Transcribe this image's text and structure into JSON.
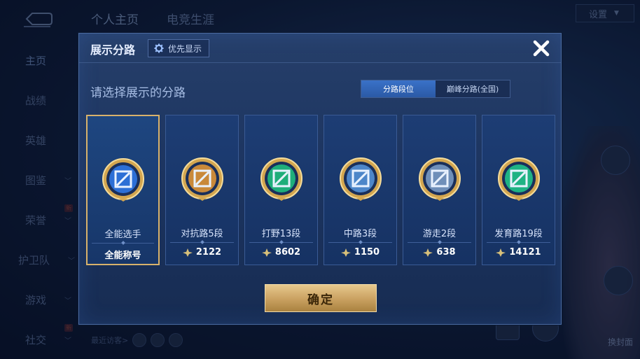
{
  "background": {
    "top_tabs": [
      "个人主页",
      "电竞生涯"
    ],
    "settings_label": "设置",
    "side_nav": [
      {
        "label": "主页"
      },
      {
        "label": "战绩"
      },
      {
        "label": "英雄"
      },
      {
        "label": "图鉴"
      },
      {
        "label": "荣誉"
      },
      {
        "label": "护卫队"
      },
      {
        "label": "游戏"
      },
      {
        "label": "社交"
      }
    ],
    "new_badge": "新",
    "recent_visitors": "最近访客>",
    "replace_cover": "换封面"
  },
  "dialog": {
    "title": "展示分路",
    "priority_button": "优先显示",
    "choose_label": "请选择展示的分路",
    "segment": {
      "options": [
        "分路段位",
        "巅峰分路(全国)"
      ],
      "selected": "分路段位"
    },
    "cards": [
      {
        "role": "全能选手",
        "score": "全能称号",
        "selected": true,
        "emblem": "all-round-emblem-icon",
        "color": "#2c6fd6"
      },
      {
        "role": "对抗路5段",
        "score": "2122",
        "selected": false,
        "emblem": "clash-lane-emblem-icon",
        "color": "#c9893a"
      },
      {
        "role": "打野13段",
        "score": "8602",
        "selected": false,
        "emblem": "jungle-emblem-icon",
        "color": "#1fae7a"
      },
      {
        "role": "中路3段",
        "score": "1150",
        "selected": false,
        "emblem": "mid-lane-emblem-icon",
        "color": "#4d86c9"
      },
      {
        "role": "游走2段",
        "score": "638",
        "selected": false,
        "emblem": "roam-emblem-icon",
        "color": "#6f8fb9"
      },
      {
        "role": "发育路19段",
        "score": "14121",
        "selected": false,
        "emblem": "farm-lane-emblem-icon",
        "color": "#1fb384"
      }
    ],
    "confirm_label": "确定"
  },
  "colors": {
    "accent_gold": "#d8b26b",
    "dialog_bg": "#1c3460",
    "segment_active": "#2b5aa6"
  }
}
